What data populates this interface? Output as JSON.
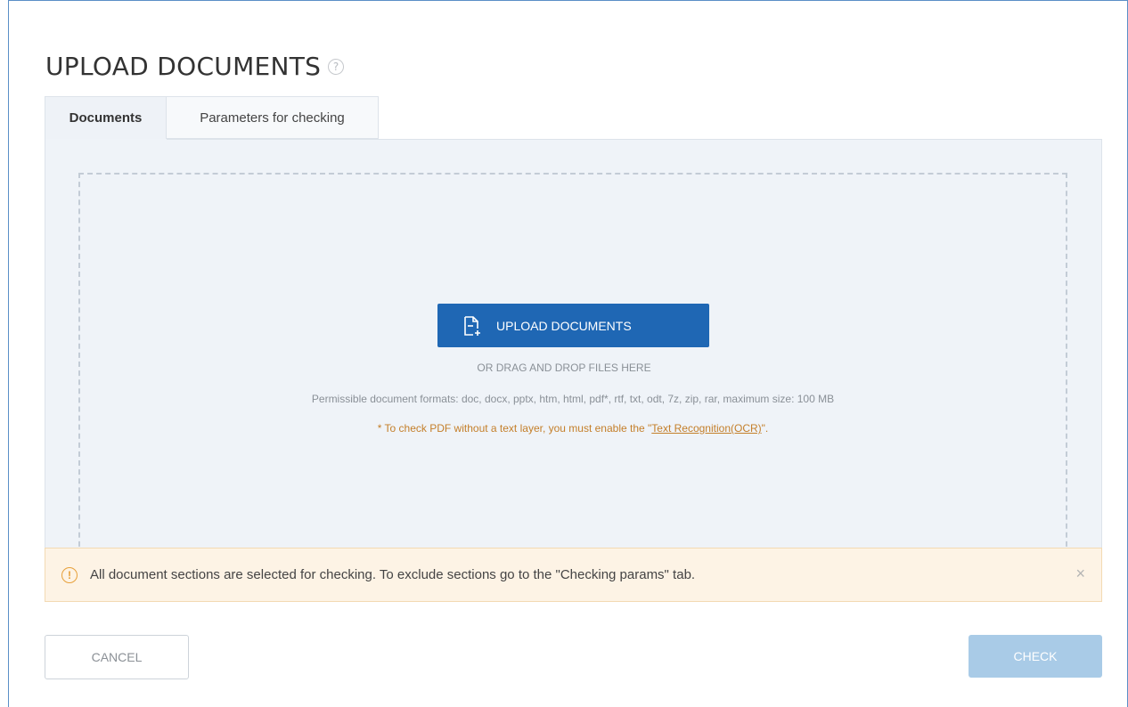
{
  "header": {
    "title": "UPLOAD DOCUMENTS",
    "help_icon": "?"
  },
  "tabs": [
    {
      "label": "Documents",
      "active": true
    },
    {
      "label": "Parameters for checking",
      "active": false
    }
  ],
  "dropzone": {
    "upload_button_label": "UPLOAD DOCUMENTS",
    "upload_icon": "file-add-icon",
    "drag_text": "OR DRAG AND DROP FILES HERE",
    "formats_text": "Permissible document formats: doc, docx, pptx, htm, html, pdf*, rtf, txt, odt, 7z, zip, rar, maximum size: 100 MB",
    "ocr_prefix": "* To check PDF without a text layer, you must enable the \"",
    "ocr_link": "Text Recognition(OCR)",
    "ocr_suffix": "\"."
  },
  "alert": {
    "icon": "info-icon",
    "text": "All document sections are selected for checking. To exclude sections go to the \"Checking params\" tab.",
    "close": "×"
  },
  "footer": {
    "cancel_label": "CANCEL",
    "check_label": "CHECK"
  },
  "colors": {
    "primary": "#1f67b4",
    "check_disabled": "#a9cbe7",
    "warning_bg": "#fdf3e5",
    "warning_accent": "#e7a03a"
  }
}
